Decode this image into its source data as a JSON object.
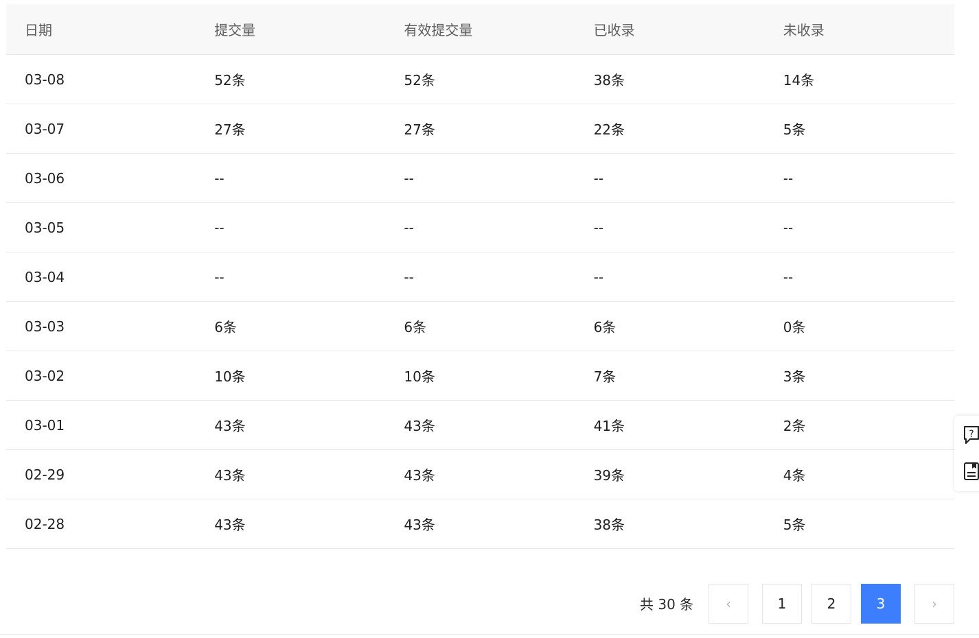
{
  "table": {
    "columns": [
      "日期",
      "提交量",
      "有效提交量",
      "已收录",
      "未收录"
    ],
    "rows": [
      [
        "03-08",
        "52条",
        "52条",
        "38条",
        "14条"
      ],
      [
        "03-07",
        "27条",
        "27条",
        "22条",
        "5条"
      ],
      [
        "03-06",
        "--",
        "--",
        "--",
        "--"
      ],
      [
        "03-05",
        "--",
        "--",
        "--",
        "--"
      ],
      [
        "03-04",
        "--",
        "--",
        "--",
        "--"
      ],
      [
        "03-03",
        "6条",
        "6条",
        "6条",
        "0条"
      ],
      [
        "03-02",
        "10条",
        "10条",
        "7条",
        "3条"
      ],
      [
        "03-01",
        "43条",
        "43条",
        "41条",
        "2条"
      ],
      [
        "02-29",
        "43条",
        "43条",
        "39条",
        "4条"
      ],
      [
        "02-28",
        "43条",
        "43条",
        "38条",
        "5条"
      ]
    ]
  },
  "pagination": {
    "total_label": "共 30 条",
    "prev_glyph": "‹",
    "next_glyph": "›",
    "pages": [
      "1",
      "2",
      "3"
    ],
    "current_page": "3",
    "active_color": "#3d7eff"
  },
  "side_panel": {
    "icons": [
      "help-chat-icon",
      "feedback-doc-icon"
    ]
  }
}
